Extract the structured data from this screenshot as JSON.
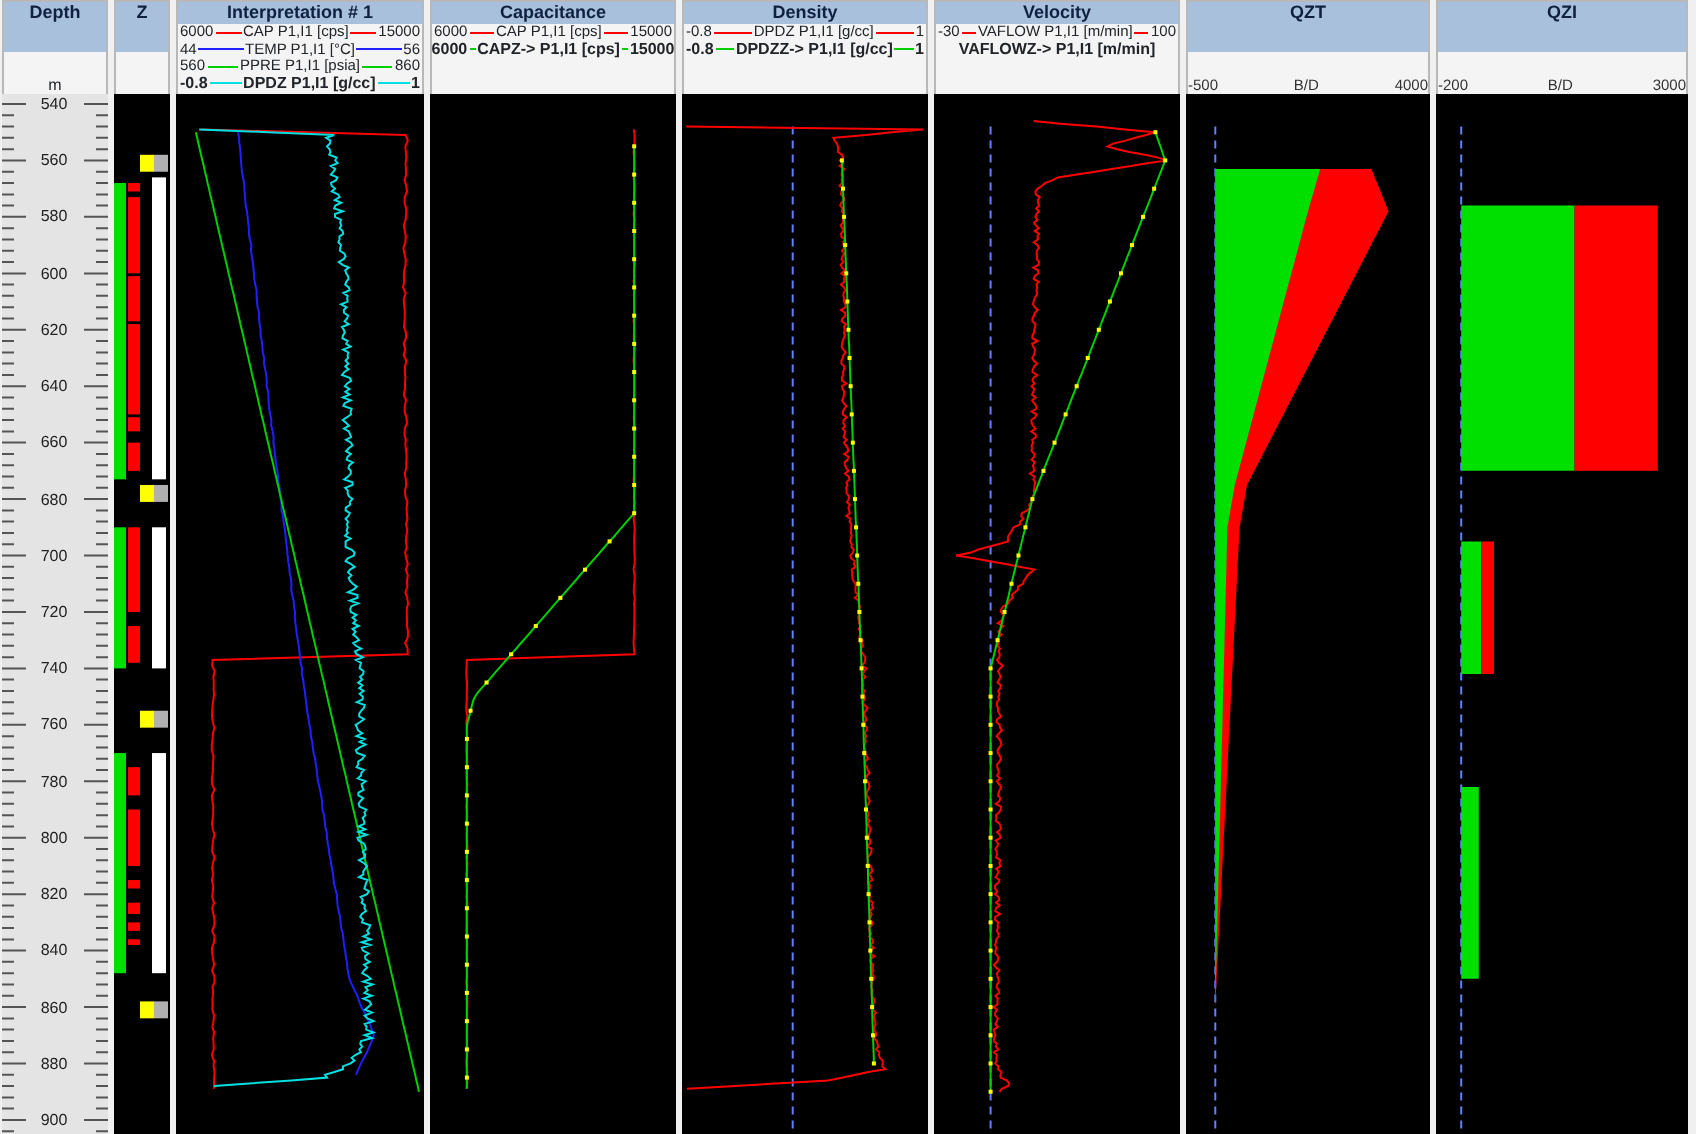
{
  "tracks": [
    {
      "kind": "depth",
      "title": "Depth",
      "unit": "m",
      "depth_labels": [
        "540",
        "560",
        "580",
        "600",
        "620",
        "640",
        "660",
        "680",
        "700",
        "720",
        "740",
        "760",
        "780",
        "800",
        "820",
        "840",
        "860",
        "880",
        "900"
      ]
    },
    {
      "kind": "zone",
      "title": "Z"
    },
    {
      "kind": "curves",
      "title": "Interpretation # 1",
      "legend": [
        {
          "min": "6000",
          "name": "CAP  P1,I1 [cps]",
          "max": "15000",
          "color": "#ff0000",
          "bold": false
        },
        {
          "min": "44",
          "name": "TEMP  P1,I1 [°C]",
          "max": "56",
          "color": "#2020ff",
          "bold": false
        },
        {
          "min": "560",
          "name": "PPRE  P1,I1 [psia]",
          "max": "860",
          "color": "#00d000",
          "bold": false
        },
        {
          "min": "-0.8",
          "name": "DPDZ  P1,I1 [g/cc]",
          "max": "1",
          "color": "#00e0e0",
          "bold": true
        }
      ]
    },
    {
      "kind": "curves",
      "title": "Capacitance",
      "legend": [
        {
          "min": "6000",
          "name": "CAP  P1,I1 [cps]",
          "max": "15000",
          "color": "#ff0000",
          "bold": false
        },
        {
          "min": "6000",
          "name": "CAPZ->  P1,I1 [cps]",
          "max": "15000",
          "color": "#00d000",
          "bold": true
        }
      ]
    },
    {
      "kind": "curves",
      "title": "Density",
      "legend": [
        {
          "min": "-0.8",
          "name": "DPDZ  P1,I1 [g/cc]",
          "max": "1",
          "color": "#ff0000",
          "bold": false
        },
        {
          "min": "-0.8",
          "name": "DPDZZ->  P1,I1 [g/cc]",
          "max": "1",
          "color": "#00d000",
          "bold": true
        }
      ]
    },
    {
      "kind": "curves",
      "title": "Velocity",
      "legend": [
        {
          "min": "-30",
          "name": "VAFLOW  P1,I1 [m/min]",
          "max": "100",
          "color": "#ff0000",
          "bold": false
        },
        {
          "name": "VAFLOWZ->  P1,I1 [m/min]",
          "color": "#00d000",
          "bold": true
        }
      ]
    },
    {
      "kind": "flow",
      "title": "QZT",
      "scale": {
        "min": "-500",
        "unit": "B/D",
        "max": "4000"
      }
    },
    {
      "kind": "flow",
      "title": "QZI",
      "scale": {
        "min": "-200",
        "unit": "B/D",
        "max": "3000"
      }
    }
  ]
}
